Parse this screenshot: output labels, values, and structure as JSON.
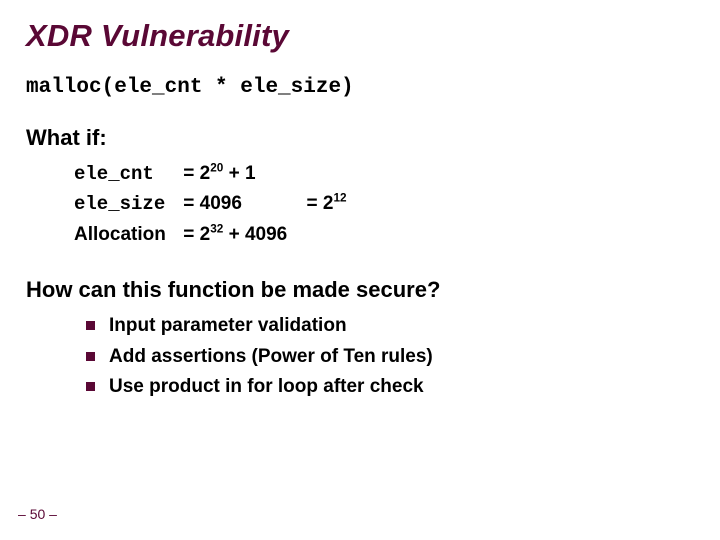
{
  "title": "XDR Vulnerability",
  "code_line": "malloc(ele_cnt * ele_size)",
  "whatif_heading": "What if:",
  "whatif": {
    "ele_cnt_label": "ele_cnt",
    "ele_cnt_eq_prefix": "= 2",
    "ele_cnt_exp": "20",
    "ele_cnt_eq_suffix": " + 1",
    "ele_size_label": "ele_size",
    "ele_size_eq": "= 4096",
    "ele_size_eq2_prefix": "= 2",
    "ele_size_exp": "12",
    "alloc_label": "Allocation",
    "alloc_eq_prefix": "= 2",
    "alloc_exp": "32",
    "alloc_eq_suffix": " + 4096"
  },
  "secure_heading": "How can this function be made secure?",
  "bullets": [
    "Input parameter validation",
    "Add assertions (Power of Ten rules)",
    "Use product in for loop after check"
  ],
  "page_prefix": "– ",
  "page_num": "50",
  "page_suffix": " –"
}
